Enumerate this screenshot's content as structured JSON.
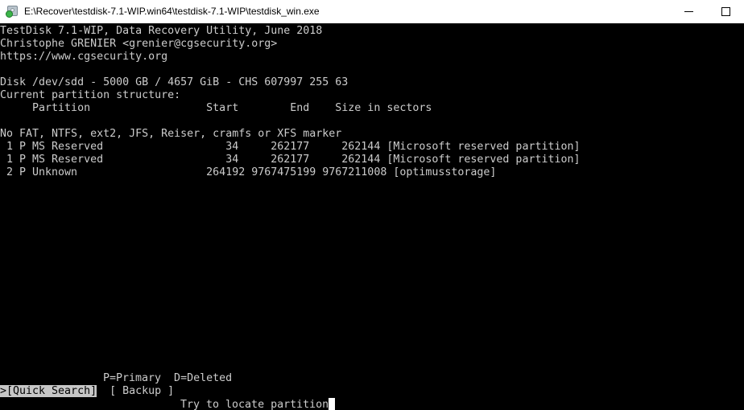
{
  "window": {
    "title": "E:\\Recover\\testdisk-7.1-WIP.win64\\testdisk-7.1-WIP\\testdisk_win.exe",
    "icon": "testdisk-disk-icon",
    "controls": {
      "minimize_label": "—",
      "maximize_label": "☐"
    },
    "titlebar_bg": "#ffffff",
    "titlebar_fg": "#000000"
  },
  "terminal": {
    "background": "#000000",
    "foreground": "#cccccc",
    "highlight_bg": "#c6c6c6",
    "highlight_fg": "#000000",
    "header": {
      "line1": "TestDisk 7.1-WIP, Data Recovery Utility, June 2018",
      "line2": "Christophe GRENIER <grenier@cgsecurity.org>",
      "line3": "https://www.cgsecurity.org"
    },
    "disk": {
      "line": "Disk /dev/sdd - 5000 GB / 4657 GiB - CHS 607997 255 63",
      "device": "/dev/sdd",
      "size_gb": "5000 GB",
      "size_gib": "4657 GiB",
      "chs": "CHS 607997 255 63"
    },
    "structure_label": "Current partition structure:",
    "table": {
      "header": "     Partition                  Start        End    Size in sectors",
      "columns": [
        "Partition",
        "Start",
        "End",
        "Size in sectors"
      ],
      "warning": "No FAT, NTFS, ext2, JFS, Reiser, cramfs or XFS marker",
      "rows": [
        {
          "line": " 1 P MS Reserved                   34     262177     262144 [Microsoft reserved partition]",
          "index": "1",
          "flag": "P",
          "type": "MS Reserved",
          "start": "34",
          "end": "262177",
          "size": "262144",
          "label": "[Microsoft reserved partition]"
        },
        {
          "line": " 1 P MS Reserved                   34     262177     262144 [Microsoft reserved partition]",
          "index": "1",
          "flag": "P",
          "type": "MS Reserved",
          "start": "34",
          "end": "262177",
          "size": "262144",
          "label": "[Microsoft reserved partition]"
        },
        {
          "line": " 2 P Unknown                    264192 9767475199 9767211008 [optimusstorage]",
          "index": "2",
          "flag": "P",
          "type": "Unknown",
          "start": "264192",
          "end": "9767475199",
          "size": "9767211008",
          "label": "[optimusstorage]"
        }
      ]
    },
    "legend": "P=Primary  D=Deleted",
    "menu": {
      "selected_marker": ">",
      "items": [
        {
          "text": "[Quick Search]",
          "selected": true
        },
        {
          "text": "[ Backup ]",
          "selected": false
        }
      ],
      "quick_search_cell": ">[Quick Search]",
      "backup_cell": "[ Backup ]"
    },
    "status": "Try to locate partition"
  }
}
